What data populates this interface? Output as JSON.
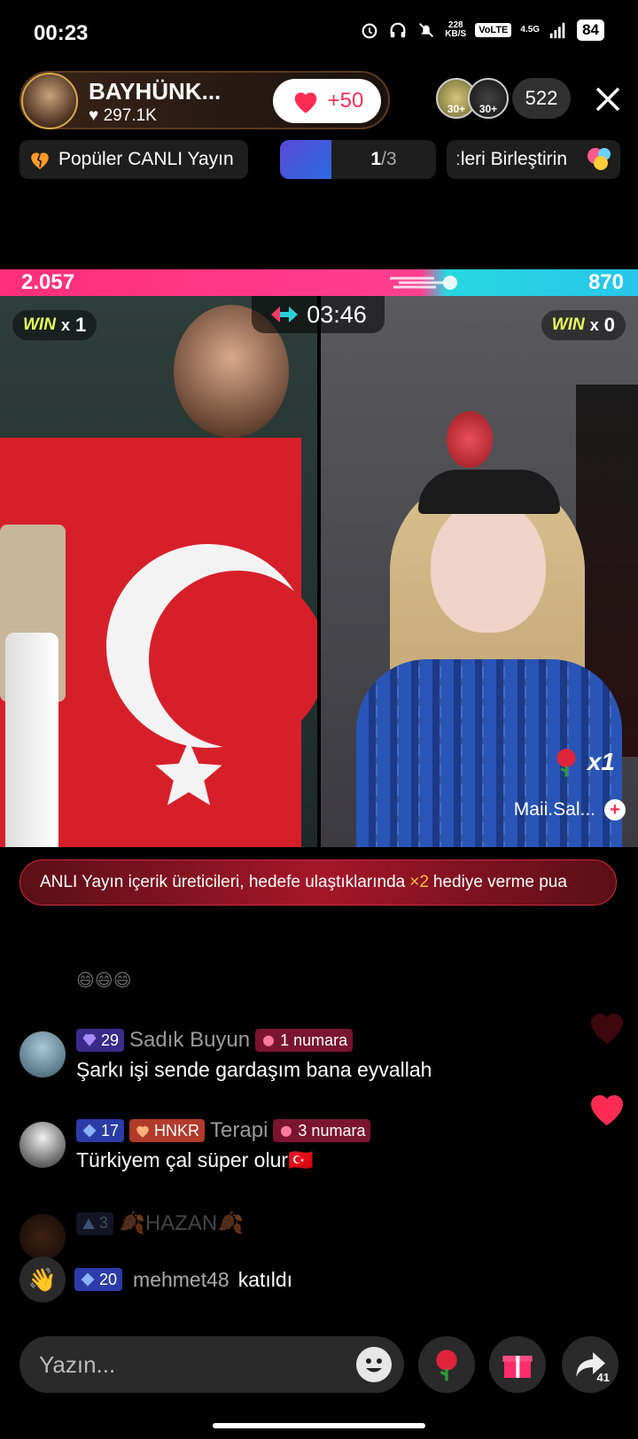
{
  "status_bar": {
    "time": "00:23",
    "speed_value": "228",
    "speed_unit": "KB/S",
    "volte": "VoLTE",
    "network": "4.5G",
    "battery": "84"
  },
  "host": {
    "name": "BAYHÜNK...",
    "likes": "297.1K",
    "plus_points": "+50"
  },
  "viewers": {
    "badge1": "30+",
    "badge2": "30+",
    "count": "522"
  },
  "chips": {
    "popular": "Popüler CANLI Yayın",
    "page_current": "1",
    "page_total": "/3",
    "merge": "ːleri Birleştirin"
  },
  "battle": {
    "left_score": "2.057",
    "right_score": "870",
    "timer": "03:46",
    "win_label": "WIN",
    "left_win_x": "x",
    "left_win": "1",
    "right_win_x": "x",
    "right_win": "0",
    "gift_count": "x1",
    "opponent_name": "Maii.Sal..."
  },
  "banner": {
    "text_before": "ANLI Yayın içerik üreticileri, hedefe ulaştıklarında",
    "highlight": "×2",
    "text_after": "hediye verme pua"
  },
  "comments": [
    {
      "level": "29",
      "username": "Sadık Buyun",
      "rank_badge": "1 numara",
      "text": "Şarkı işi sende gardaşım bana eyvallah"
    },
    {
      "level": "17",
      "team": "HNKR",
      "username": "Terapi",
      "rank_badge": "3 numara",
      "text": "Türkiyem çal süper olur🇹🇷"
    },
    {
      "level": "3",
      "username": "🍂HAZAN🍂"
    }
  ],
  "emoji_line": "😄😄😄",
  "joined": {
    "level": "20",
    "username": "mehmet48",
    "action": "katıldı"
  },
  "input": {
    "placeholder": "Yazın..."
  },
  "share_count": "41",
  "colors": {
    "accent_pink": "#fe2c55",
    "score_left": "#ff2e7a",
    "score_right": "#27c6ea",
    "win_yellow": "#e8ff57"
  }
}
